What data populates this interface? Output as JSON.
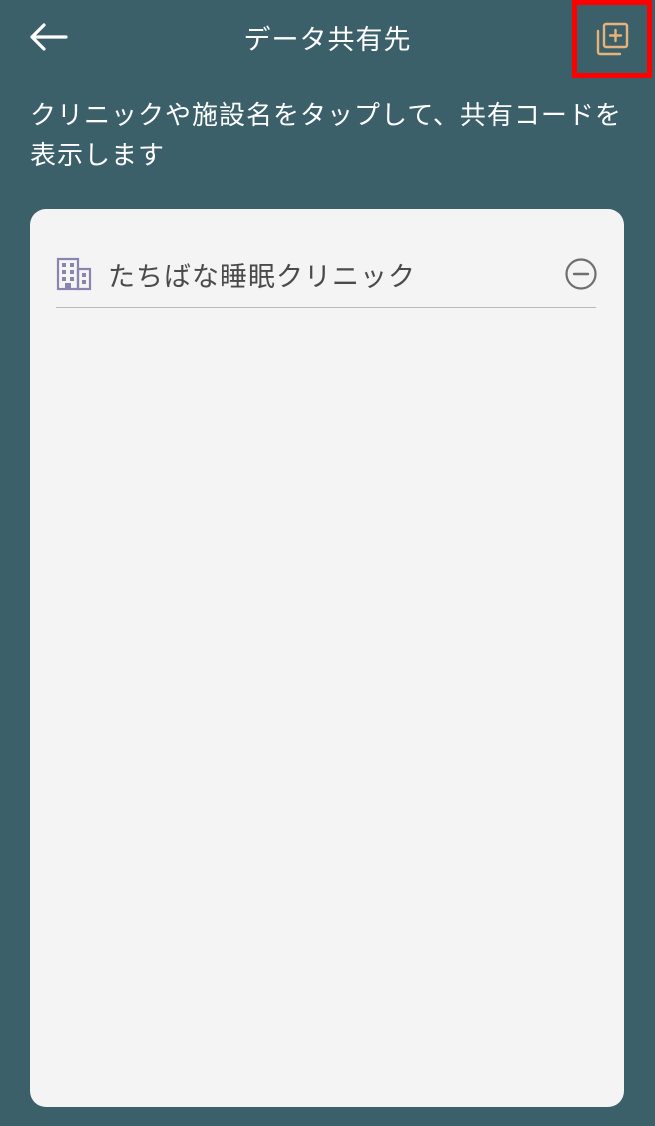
{
  "header": {
    "title": "データ共有先",
    "back_icon": "arrow-left-icon",
    "add_icon": "add-to-library-icon",
    "add_icon_color": "#e8b37a"
  },
  "instruction": "クリニックや施設名をタップして、共有コードを表示します",
  "clinics": [
    {
      "name": "たちばな睡眠クリニック",
      "icon": "building-icon",
      "action_icon": "minus-circle-icon"
    }
  ],
  "colors": {
    "background": "#3b606a",
    "card": "#f4f4f4",
    "building_icon": "#8a85b0",
    "highlight_border": "#ff0000"
  }
}
